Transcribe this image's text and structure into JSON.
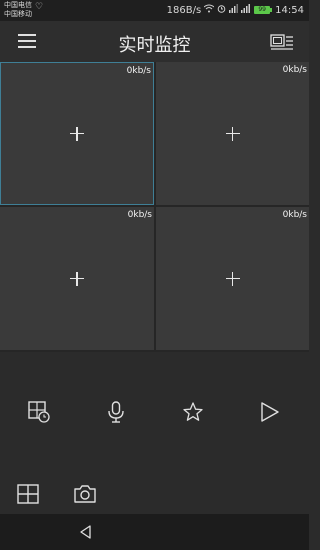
{
  "status_bar": {
    "carrier_line1": "中国电信",
    "carrier_line2": "中国移动",
    "net_speed": "186B/s",
    "battery": "99",
    "time": "14:54"
  },
  "header": {
    "title": "实时监控",
    "menu_icon": "hamburger-menu-icon",
    "device_list_icon": "device-list-icon"
  },
  "video_grid": {
    "cells": [
      {
        "rate": "0kb/s",
        "selected": true
      },
      {
        "rate": "0kb/s",
        "selected": false
      },
      {
        "rate": "0kb/s",
        "selected": false
      },
      {
        "rate": "0kb/s",
        "selected": false
      }
    ]
  },
  "controls": [
    "playback-grid-icon",
    "microphone-icon",
    "star-icon",
    "play-icon"
  ],
  "bottom_tools": [
    "split-screen-icon",
    "camera-snapshot-icon"
  ],
  "nav": {
    "back_icon": "back-triangle-icon"
  },
  "colors": {
    "selected_border": "#3f7f96",
    "battery": "#5cc84a",
    "cell_bg": "#3a3a3a"
  }
}
